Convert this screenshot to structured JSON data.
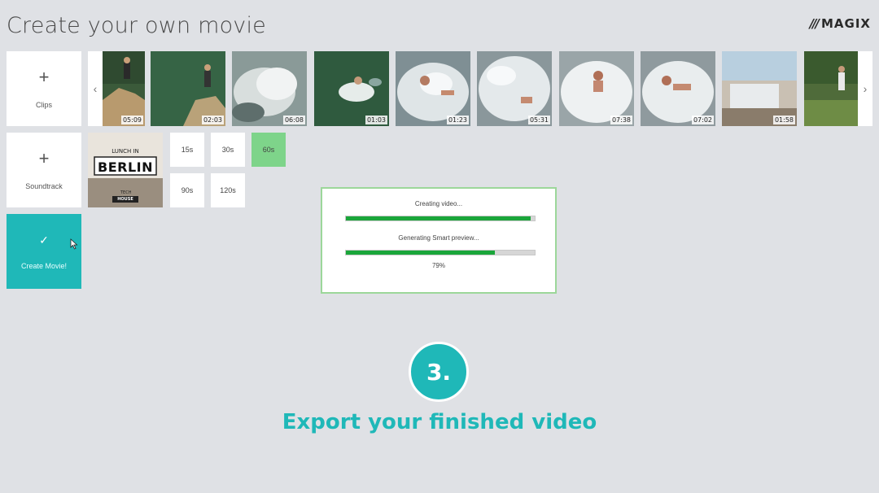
{
  "header": {
    "title": "Create your own movie",
    "logo_text": "MAGIX",
    "logo_mark": "///"
  },
  "tiles": {
    "clips_label": "Clips",
    "soundtrack_label": "Soundtrack",
    "create_label": "Create Movie!",
    "plus": "+",
    "check": "✓"
  },
  "nav": {
    "prev": "‹",
    "next": "›"
  },
  "clips": [
    {
      "duration": "05:09"
    },
    {
      "duration": "02:03"
    },
    {
      "duration": "06:08"
    },
    {
      "duration": "01:03"
    },
    {
      "duration": "01:23"
    },
    {
      "duration": "05:31"
    },
    {
      "duration": "07:38"
    },
    {
      "duration": "07:02"
    },
    {
      "duration": "01:58"
    },
    {
      "duration": ""
    }
  ],
  "soundtrack": {
    "top": "LUNCH IN",
    "main": "BERLIN",
    "sub": "HOUSE",
    "tag": "TECH"
  },
  "durations": [
    "15s",
    "30s",
    "60s",
    "90s",
    "120s"
  ],
  "selected_duration": "60s",
  "progress": {
    "creating_label": "Creating video...",
    "creating_fraction": 0.98,
    "preview_label": "Generating Smart preview...",
    "preview_fraction": 0.79,
    "percent_text": "79%"
  },
  "step": {
    "number": "3.",
    "caption": "Export your finished video"
  },
  "colors": {
    "accent": "#1fb8b8",
    "progress": "#1aa63a",
    "selected": "#7ed48a"
  }
}
